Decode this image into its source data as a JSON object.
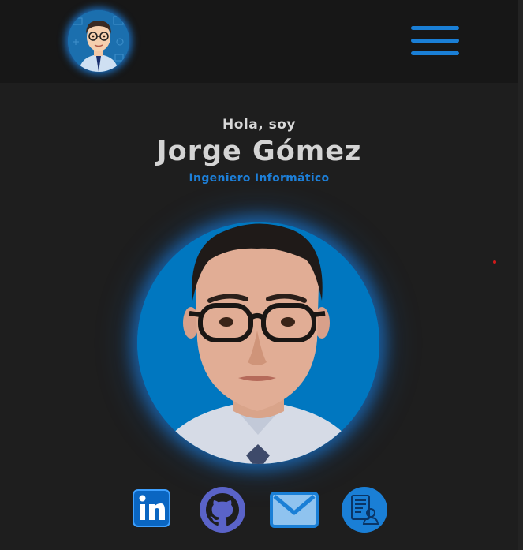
{
  "header": {
    "logo_icon": "avatar-cartoon-icon",
    "menu_icon": "hamburger-menu-icon"
  },
  "hero": {
    "greeting": "Hola, soy",
    "name": "Jorge Gómez",
    "role": "Ingeniero Informático",
    "photo_icon": "profile-photo"
  },
  "social": [
    {
      "name": "linkedin",
      "icon": "linkedin-icon"
    },
    {
      "name": "github",
      "icon": "github-icon"
    },
    {
      "name": "email",
      "icon": "mail-icon"
    },
    {
      "name": "cv",
      "icon": "resume-icon"
    }
  ],
  "colors": {
    "background": "#1e1e1e",
    "header": "#171717",
    "accent": "#1a7fd6",
    "text": "#d4d4d4",
    "github": "#5a63c8"
  }
}
